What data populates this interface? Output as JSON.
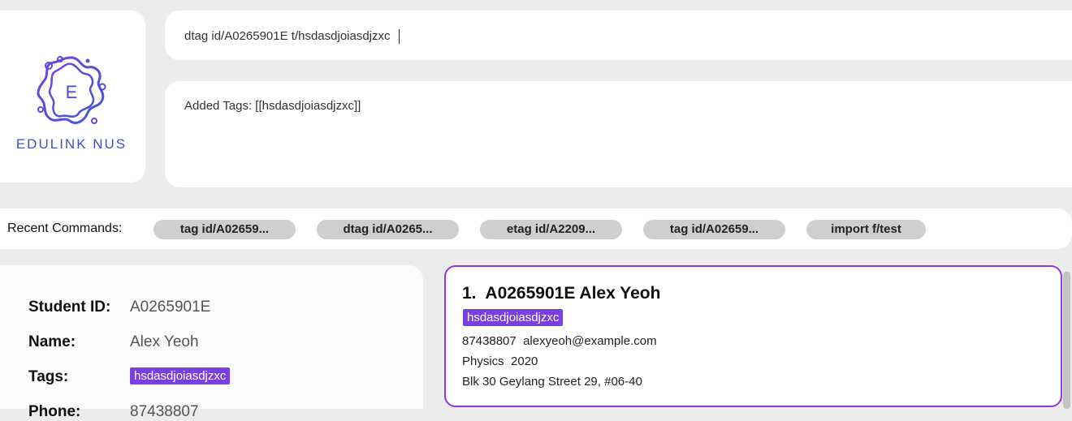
{
  "logo": {
    "monogram": "E",
    "text": "EDULINK NUS"
  },
  "command": {
    "value": "dtag id/A0265901E t/hsdasdjoiasdjzxc"
  },
  "result": {
    "text": "Added Tags: [[hsdasdjoiasdjzxc]]"
  },
  "recent": {
    "label": "Recent Commands:",
    "items": [
      "tag id/A02659...",
      "dtag id/A0265...",
      "etag id/A2209...",
      "tag id/A02659...",
      "import f/test"
    ]
  },
  "detail": {
    "student_id_label": "Student ID:",
    "student_id": "A0265901E",
    "name_label": "Name:",
    "name": "Alex Yeoh",
    "tags_label": "Tags:",
    "tags": [
      "hsdasdjoiasdjzxc"
    ],
    "phone_label": "Phone:",
    "phone": "87438807"
  },
  "list": {
    "items": [
      {
        "index": "1.",
        "id": "A0265901E",
        "name": "Alex Yeoh",
        "tags": [
          "hsdasdjoiasdjzxc"
        ],
        "phone": "87438807",
        "email": "alexyeoh@example.com",
        "major": "Physics",
        "year": "2020",
        "address": "Blk 30 Geylang Street 29, #06-40"
      }
    ]
  },
  "colors": {
    "accent": "#7b3fe0",
    "logo": "#3f4fc8",
    "card_border": "#8a3bdc"
  }
}
